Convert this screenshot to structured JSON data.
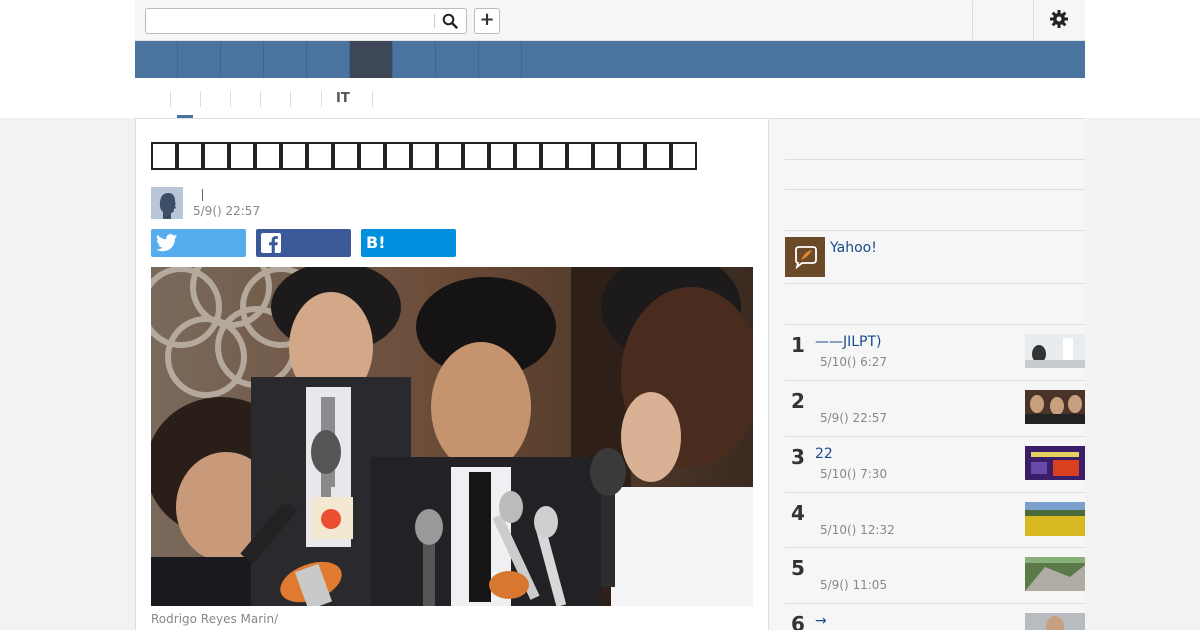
{
  "header": {
    "search_placeholder": "",
    "search_icon": "search-icon",
    "add_icon": "plus-icon",
    "add_label": "+",
    "settings_icon": "gear-icon"
  },
  "subnav": {
    "items": [
      "",
      "",
      "",
      "",
      "",
      "IT",
      ""
    ]
  },
  "article": {
    "title_glyph_count": 21,
    "date": "5/9() 22:57",
    "share": {
      "twitter_icon": "twitter-icon",
      "facebook_icon": "facebook-icon",
      "hatena_label": "B!"
    },
    "photo_caption": "Rodrigo Reyes Marin/"
  },
  "sidebar": {
    "yahoo_label": "Yahoo!",
    "ranking": [
      {
        "rank": "1",
        "title": "——JILPT)",
        "date": "5/10() 6:27"
      },
      {
        "rank": "2",
        "title": "",
        "date": "5/9() 22:57"
      },
      {
        "rank": "3",
        "title": "22",
        "date": "5/10() 7:30"
      },
      {
        "rank": "4",
        "title": "",
        "date": "5/10() 12:32"
      },
      {
        "rank": "5",
        "title": "",
        "date": "5/9() 11:05"
      },
      {
        "rank": "6",
        "title": "→",
        "date": ""
      }
    ]
  },
  "colors": {
    "nav": "#4a73a0",
    "nav_active": "#3e4757",
    "link": "#1a4b8c",
    "twitter": "#55acee",
    "facebook": "#3b5998",
    "hatena": "#008fde"
  }
}
